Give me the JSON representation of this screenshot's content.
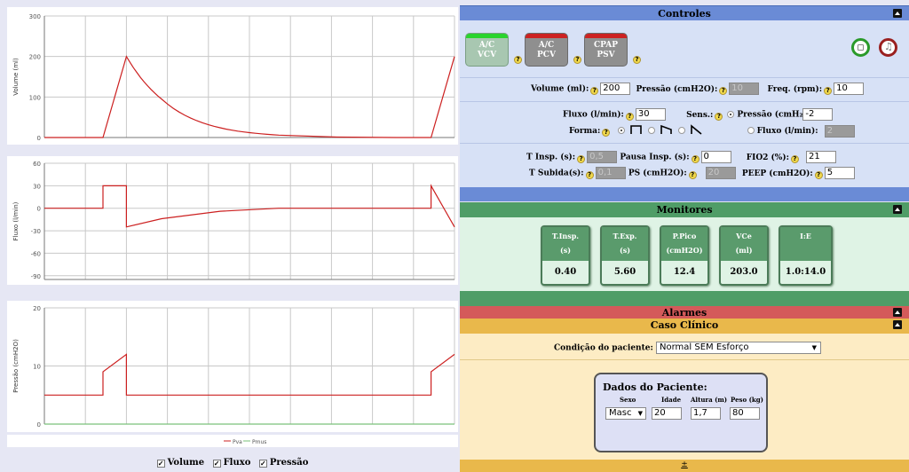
{
  "charts": {
    "volume": {
      "ylabel": "Volume (ml)",
      "ticks": [
        "300",
        "200",
        "100",
        "0"
      ],
      "color": "#cc2020"
    },
    "flow": {
      "ylabel": "Fluxo (l/min)",
      "ticks": [
        "60",
        "30",
        "0",
        "-30",
        "-60",
        "-90"
      ]
    },
    "pressure": {
      "ylabel": "Pressão (cmH2O)",
      "ticks": [
        "20",
        "10",
        "0"
      ],
      "legend_pva": "Pva",
      "legend_pmus": "Pmus"
    }
  },
  "chart_data": [
    {
      "type": "line",
      "ylabel": "Volume (ml)",
      "ylim": [
        0,
        300
      ],
      "series": [
        {
          "x": [
            0,
            1.0,
            1.4,
            2.0,
            3.0,
            4.0,
            5.0,
            6.0,
            6.6,
            7.0
          ],
          "values": [
            0,
            0,
            200,
            95,
            24,
            6,
            1,
            0,
            0,
            200
          ]
        }
      ]
    },
    {
      "type": "line",
      "ylabel": "Fluxo (l/min)",
      "ylim": [
        -95,
        60
      ],
      "series": [
        {
          "x": [
            0,
            1.0,
            1.0,
            1.4,
            1.4,
            2.0,
            3.0,
            4.0,
            6.6,
            6.6,
            7.0
          ],
          "values": [
            0,
            0,
            30,
            30,
            -25,
            -14,
            -4,
            0,
            0,
            30,
            -25
          ]
        }
      ]
    },
    {
      "type": "line",
      "ylabel": "Pressão (cmH2O)",
      "ylim": [
        0,
        20
      ],
      "series": [
        {
          "name": "Pva",
          "x": [
            0,
            1.0,
            1.0,
            1.4,
            1.4,
            6.6,
            6.6,
            7.0
          ],
          "values": [
            5,
            5,
            9,
            12,
            5,
            5,
            9,
            12
          ]
        },
        {
          "name": "Pmus",
          "x": [
            0,
            7.0
          ],
          "values": [
            0,
            0
          ]
        }
      ]
    }
  ],
  "checks": {
    "volume": "Volume",
    "flow": "Fluxo",
    "pressure": "Pressão",
    "mark": "✓"
  },
  "controles": {
    "title": "Controles",
    "modes": [
      {
        "line1": "A/C",
        "line2": "VCV"
      },
      {
        "line1": "A/C",
        "line2": "PCV"
      },
      {
        "line1": "CPAP",
        "line2": "PSV"
      }
    ],
    "help": "?",
    "volume_label": "Volume (ml):",
    "volume": "200",
    "pressao_label": "Pressão (cmH2O):",
    "pressao": "10",
    "freq_label": "Freq. (rpm):",
    "freq": "10",
    "fluxo_label": "Fluxo (l/min):",
    "fluxo": "30",
    "sens_label": "Sens.:",
    "sens_pressao_label": "Pressão (cmH₂",
    "sens_pressao": "-2",
    "sens_fluxo_label": "Fluxo (l/min):",
    "sens_fluxo": "2",
    "forma_label": "Forma:",
    "tinsp_label": "T Insp. (s):",
    "tinsp": "0,5",
    "pausa_label": "Pausa Insp. (s):",
    "pausa": "0",
    "fio2_label": "FIO2 (%):",
    "fio2": "21",
    "tsubida_label": "T Subida(s):",
    "tsubida": "0,1",
    "ps_label": "PS (cmH2O):",
    "ps": "20",
    "peep_label": "PEEP (cmH2O):",
    "peep": "5"
  },
  "monitores": {
    "title": "Monitores",
    "items": [
      {
        "l1": "T.Insp.",
        "l2": "(s)",
        "value": "0.40"
      },
      {
        "l1": "T.Exp.",
        "l2": "(s)",
        "value": "5.60"
      },
      {
        "l1": "P.Pico",
        "l2": "(cmH2O)",
        "value": "12.4"
      },
      {
        "l1": "VCe",
        "l2": "(ml)",
        "value": "203.0"
      },
      {
        "l1": "I:E",
        "l2": "",
        "value": "1.0:14.0"
      }
    ]
  },
  "alarmes": {
    "title": "Alarmes"
  },
  "caso": {
    "title": "Caso Clínico",
    "condicao_label": "Condição do paciente:",
    "condicao": "Normal SEM Esforço",
    "dados_title": "Dados do Paciente:",
    "sexo_label": "Sexo",
    "idade_label": "Idade",
    "altura_label": "Altura (m)",
    "peso_label": "Peso (kg)",
    "sexo": "Masc",
    "idade": "20",
    "altura": "1,7",
    "peso": "80"
  },
  "footer": {
    "expand": "±"
  }
}
